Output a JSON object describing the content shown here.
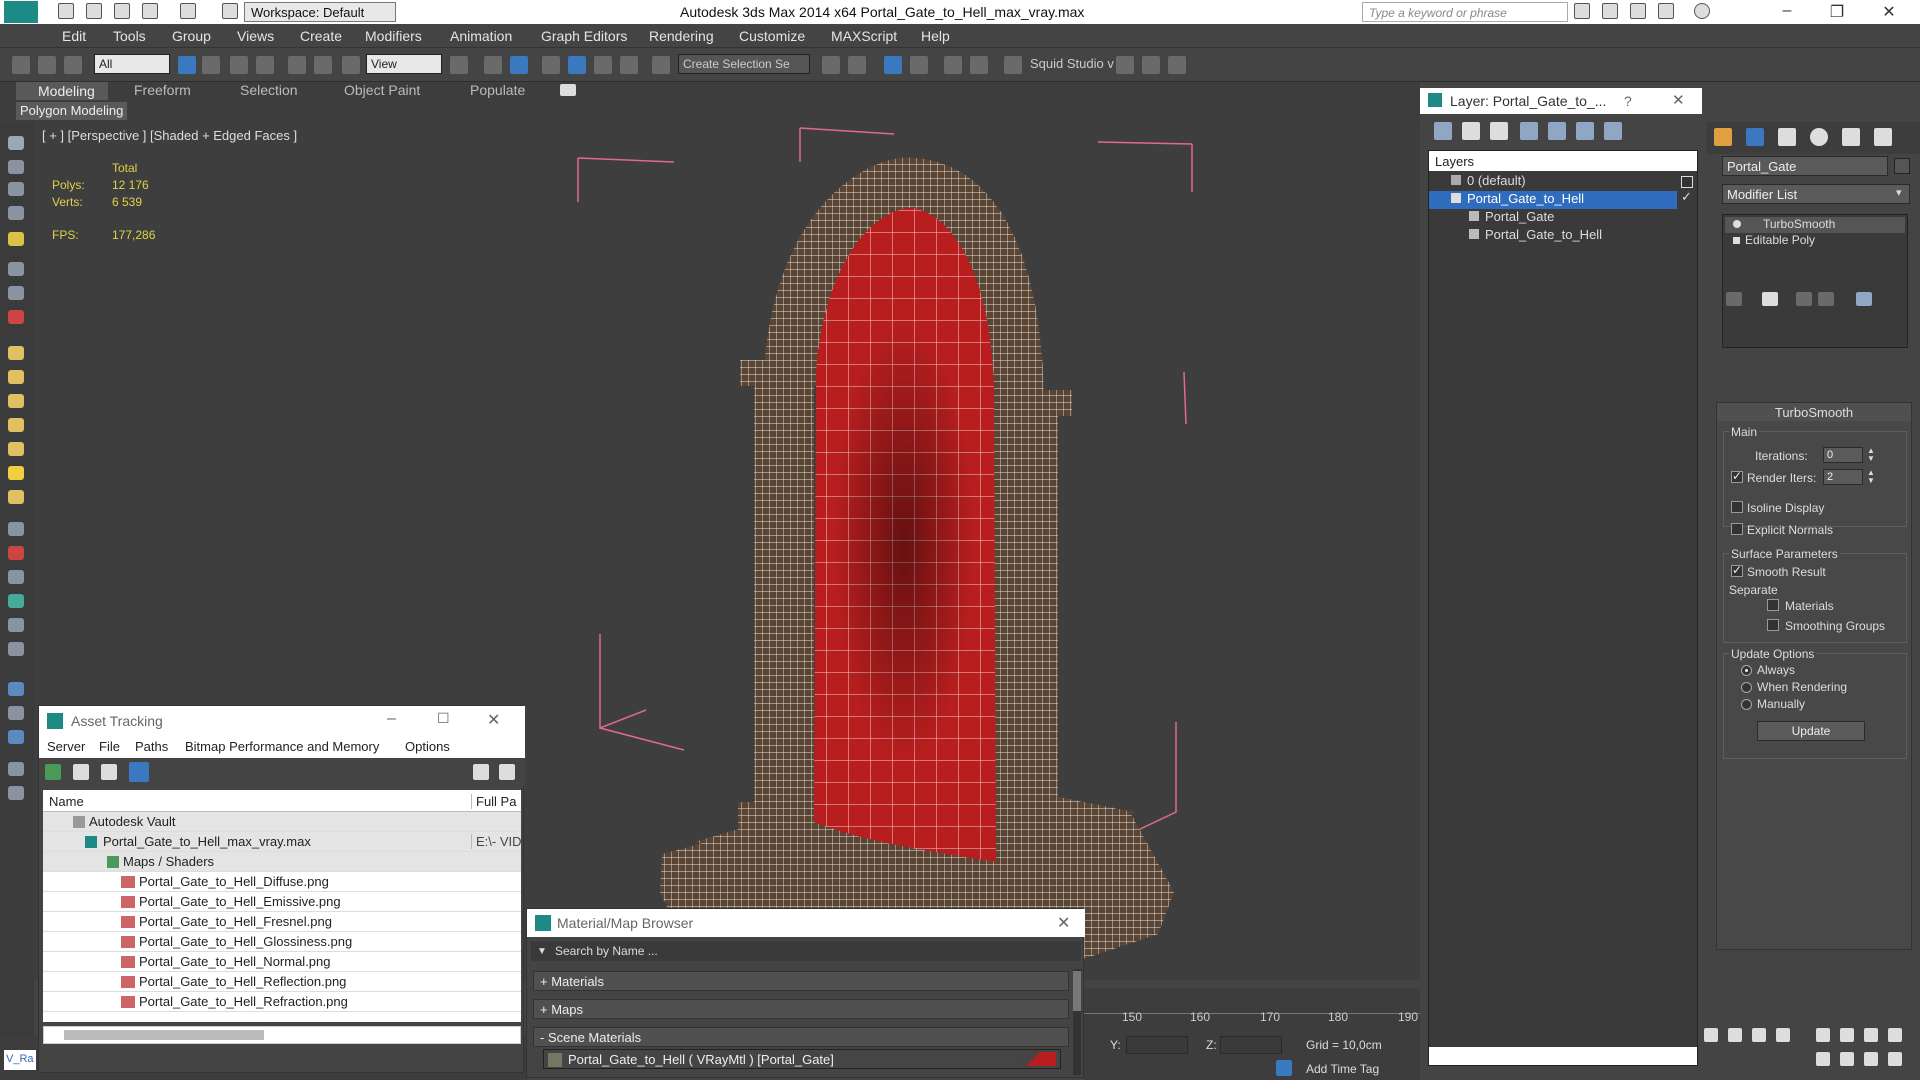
{
  "window": {
    "title": "Autodesk 3ds Max  2014 x64     Portal_Gate_to_Hell_max_vray.max",
    "workspace": "Workspace: Default",
    "search_placeholder": "Type a keyword or phrase"
  },
  "menu": [
    "Edit",
    "Tools",
    "Group",
    "Views",
    "Create",
    "Modifiers",
    "Animation",
    "Graph Editors",
    "Rendering",
    "Customize",
    "MAXScript",
    "Help"
  ],
  "toolbar": {
    "filter": "All",
    "ref_coord": "View",
    "selection_set": "Create Selection Se",
    "squid": "Squid Studio v"
  },
  "ribbon": {
    "tabs": [
      "Modeling",
      "Freeform",
      "Selection",
      "Object Paint",
      "Populate"
    ],
    "active_tab": "Modeling",
    "sub": "Polygon Modeling"
  },
  "viewport": {
    "label": "[ + ] [Perspective ] [Shaded + Edged Faces ]",
    "stats": {
      "total_label": "Total",
      "polys_label": "Polys:",
      "polys": "12 176",
      "verts_label": "Verts:",
      "verts": "6 539",
      "fps_label": "FPS:",
      "fps": "177,286"
    }
  },
  "layer_panel": {
    "title": "Layer: Portal_Gate_to_...",
    "help": "?",
    "tree_header": "Layers",
    "rows": [
      {
        "label": "0 (default)"
      },
      {
        "label": "Portal_Gate_to_Hell"
      },
      {
        "label": "Portal_Gate"
      },
      {
        "label": "Portal_Gate_to_Hell"
      }
    ]
  },
  "command_panel": {
    "object_name": "Portal_Gate",
    "modifier_list": "Modifier List",
    "stack": [
      "TurboSmooth",
      "Editable Poly"
    ],
    "rollout_title": "TurboSmooth",
    "main_label": "Main",
    "iterations_label": "Iterations:",
    "iterations": "0",
    "render_iters_label": "Render Iters:",
    "render_iters": "2",
    "isoline": "Isoline Display",
    "explicit_normals": "Explicit Normals",
    "surface_params": "Surface Parameters",
    "smooth_result": "Smooth Result",
    "separate": "Separate",
    "materials": "Materials",
    "smoothing_groups": "Smoothing Groups",
    "update_options": "Update Options",
    "always": "Always",
    "when_rendering": "When Rendering",
    "manually": "Manually",
    "update_button": "Update"
  },
  "asset_tracking": {
    "title": "Asset Tracking",
    "menu": [
      "Server",
      "File",
      "Paths",
      "Bitmap Performance and Memory",
      "Options"
    ],
    "col_name": "Name",
    "col_path": "Full Pa",
    "rows": [
      {
        "label": "Autodesk Vault",
        "path": ""
      },
      {
        "label": "Portal_Gate_to_Hell_max_vray.max",
        "path": "E:\\- VID"
      },
      {
        "label": "Maps / Shaders",
        "path": ""
      },
      {
        "label": "Portal_Gate_to_Hell_Diffuse.png",
        "path": ""
      },
      {
        "label": "Portal_Gate_to_Hell_Emissive.png",
        "path": ""
      },
      {
        "label": "Portal_Gate_to_Hell_Fresnel.png",
        "path": ""
      },
      {
        "label": "Portal_Gate_to_Hell_Glossiness.png",
        "path": ""
      },
      {
        "label": "Portal_Gate_to_Hell_Normal.png",
        "path": ""
      },
      {
        "label": "Portal_Gate_to_Hell_Reflection.png",
        "path": ""
      },
      {
        "label": "Portal_Gate_to_Hell_Refraction.png",
        "path": ""
      }
    ]
  },
  "material_browser": {
    "title": "Material/Map Browser",
    "search": "Search by Name ...",
    "sections": [
      "+ Materials",
      "+ Maps",
      "- Scene Materials"
    ],
    "item": "Portal_Gate_to_Hell  ( VRayMtl )  [Portal_Gate]"
  },
  "timeline": {
    "ticks": [
      "150",
      "160",
      "170",
      "180",
      "190"
    ],
    "y_label": "Y:",
    "z_label": "Z:",
    "grid": "Grid = 10,0cm",
    "add_time_tag": "Add Time Tag"
  },
  "statusbar": {
    "script_label": "V_Ra"
  },
  "colors": {
    "selection": "#2f6cbd",
    "portal_red": "#b81e1e",
    "bbox_pink": "#e06a8a",
    "stats_yellow": "#e0d34a"
  }
}
